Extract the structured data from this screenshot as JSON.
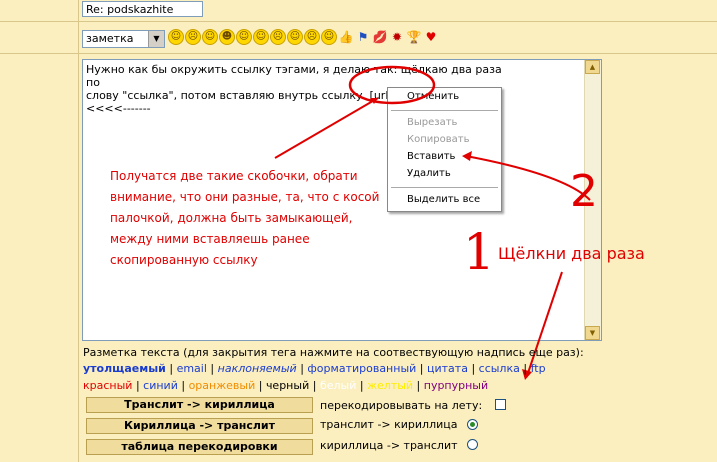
{
  "form": {
    "subject_value": "Re: podskazhite",
    "tag_select_value": "заметка",
    "body_lines": [
      "Нужно как бы окружить ссылку тэгами, я делаю так: щёлкаю два раза по",
      "слову \"ссылка\", потом вставляю внутрь ссылку  [url][/url]",
      "<<<<-------"
    ]
  },
  "smileys": [
    "☺",
    "☹",
    "☺",
    "☻",
    "☺",
    "☺",
    "☹",
    "☺",
    "☹",
    "☺"
  ],
  "extra_icons": [
    "thumbs-up-icon",
    "flag-icon",
    "lips-icon",
    "bug-icon",
    "trophy-icon",
    "heart-icon"
  ],
  "context_menu": {
    "undo": "Отменить",
    "cut": "Вырезать",
    "copy": "Копировать",
    "paste": "Вставить",
    "delete": "Удалить",
    "select_all": "Выделить все"
  },
  "annotations": {
    "explanation": [
      "Получатся две такие скобочки, обрати",
      "внимание, что они разные, та, что с косой",
      "палочкой, должна быть замыкающей,",
      "между ними вставляешь ранее",
      "скопированную ссылку"
    ],
    "double_click": "Щёлкни два раза",
    "step1": "1",
    "step2": "2"
  },
  "markup": {
    "label": "Разметка текста (для закрытия тега нажмите на соотвествующую надпись еще раз):",
    "tags_row1": [
      "утолщаемый",
      "email",
      "наклоняемый",
      "форматированный",
      "цитата",
      "ссылка",
      "ftp"
    ],
    "tags_row2": [
      "красный",
      "синий",
      "оранжевый",
      "черный",
      "белый",
      "желтый",
      "пурпурный"
    ],
    "separator": "|"
  },
  "translit": {
    "btn_translit_cyr": "Транслит -> кириллица",
    "btn_cyr_translit": "Кириллица -> транслит",
    "btn_table": "таблица перекодировки",
    "opt_live": "перекодировывать на лету:",
    "opt_t2c": "транслит -> кириллица",
    "opt_c2t": "кириллица -> транслит",
    "selected": "транслит -> кириллица"
  },
  "colors": {
    "background": "#fbefbf",
    "annotation_red": "#e00000",
    "link_blue": "#1a3ccf"
  }
}
